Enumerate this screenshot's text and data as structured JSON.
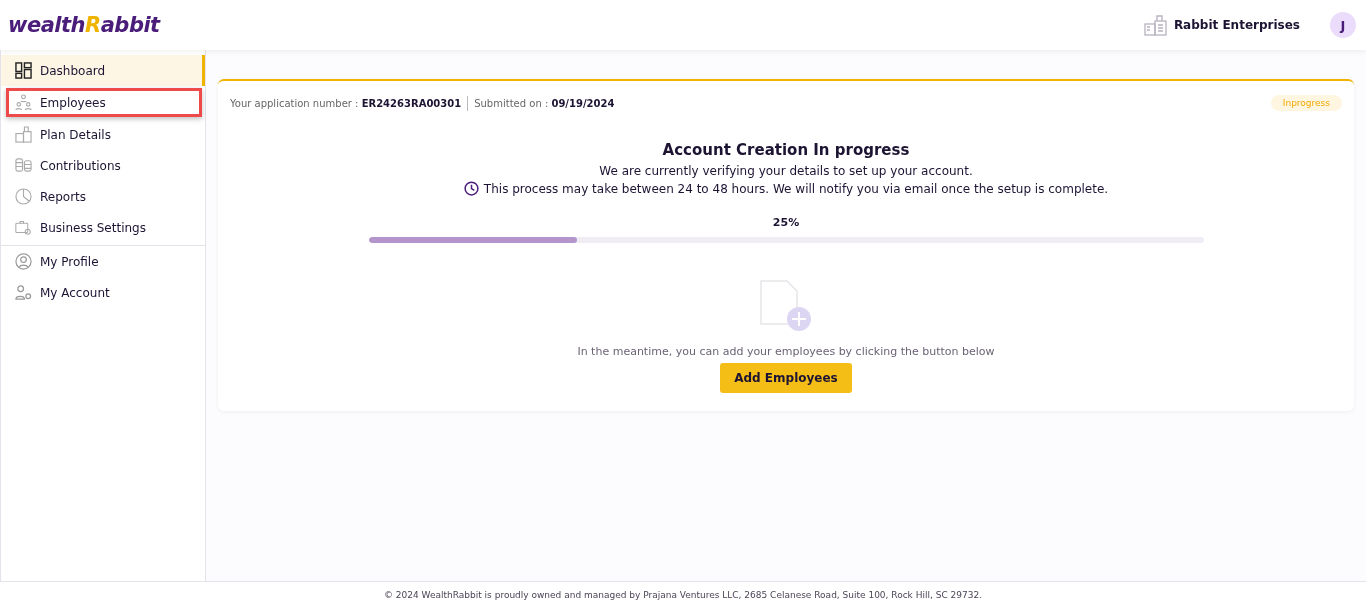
{
  "header": {
    "logo": {
      "first": "wealth",
      "accent": "R",
      "rest": "abbit"
    },
    "company": "Rabbit Enterprises",
    "avatar_initial": "J"
  },
  "sidebar": {
    "groups": [
      {
        "items": [
          {
            "label": "Dashboard",
            "kind": "dashboard",
            "selected": true,
            "highlighted": false
          },
          {
            "label": "Employees",
            "kind": "people",
            "selected": false,
            "highlighted": true
          },
          {
            "label": "Plan Details",
            "kind": "building",
            "selected": false,
            "highlighted": false
          },
          {
            "label": "Contributions",
            "kind": "coins",
            "selected": false,
            "highlighted": false
          },
          {
            "label": "Reports",
            "kind": "pie",
            "selected": false,
            "highlighted": false
          },
          {
            "label": "Business Settings",
            "kind": "briefcase",
            "selected": false,
            "highlighted": false
          }
        ]
      },
      {
        "items": [
          {
            "label": "My Profile",
            "kind": "profile",
            "selected": false,
            "highlighted": false
          },
          {
            "label": "My Account",
            "kind": "account",
            "selected": false,
            "highlighted": false
          }
        ]
      }
    ]
  },
  "card": {
    "application_label": "Your application number :",
    "application_number": "ER24263RA00301",
    "submitted_label": "Submitted on :",
    "submitted_date": "09/19/2024",
    "status": "Inprogress",
    "title": "Account Creation In progress",
    "message": "We are currently verifying your details to set up your account.",
    "notice": "This process may take between 24 to 48 hours. We will notify you via email once the setup is complete.",
    "progress": {
      "reading": "25%",
      "level": 0.25
    },
    "hint": "In the meantime, you can add your employees by clicking the button below",
    "button": "Add Employees"
  },
  "footer": "© 2024 WealthRabbit is proudly owned and managed by Prajana Ventures LLC, 2685 Celanese Road, Suite 100, Rock Hill, SC 29732."
}
